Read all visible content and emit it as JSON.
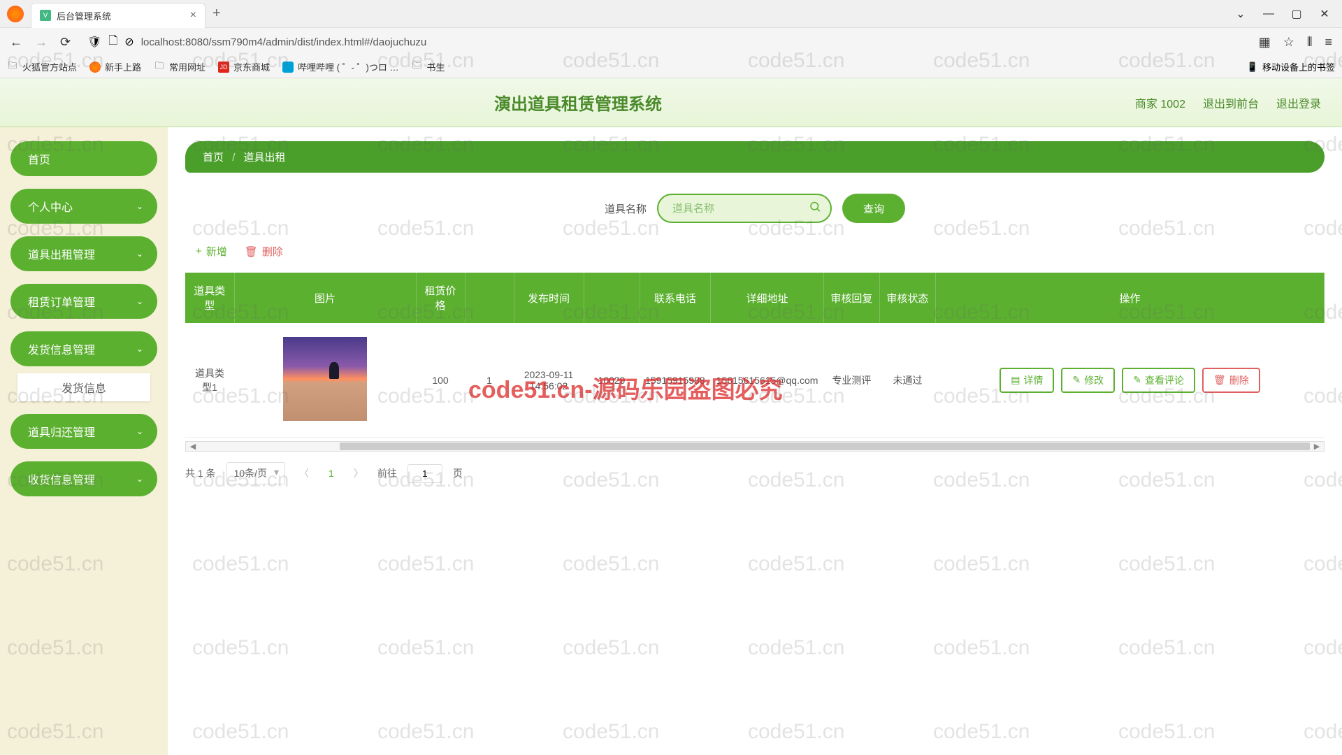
{
  "browser": {
    "tab_title": "后台管理系统",
    "url": "localhost:8080/ssm790m4/admin/dist/index.html#/daojuchuzu",
    "bookmarks": [
      "火狐官方站点",
      "新手上路",
      "常用网址",
      "京东商城",
      "哔哩哔哩 ( ゜- ゜)つロ …",
      "书生"
    ],
    "mobile_bookmarks": "移动设备上的书签"
  },
  "header": {
    "title": "演出道具租赁管理系统",
    "user": "商家 1002",
    "link_front": "退出到前台",
    "link_logout": "退出登录"
  },
  "sidebar": {
    "items": [
      {
        "label": "首页",
        "expandable": false
      },
      {
        "label": "个人中心",
        "expandable": true
      },
      {
        "label": "道具出租管理",
        "expandable": true
      },
      {
        "label": "租赁订单管理",
        "expandable": true
      },
      {
        "label": "发货信息管理",
        "expandable": true
      },
      {
        "label": "道具归还管理",
        "expandable": true
      },
      {
        "label": "收货信息管理",
        "expandable": true
      }
    ],
    "sub_item": "发货信息"
  },
  "breadcrumb": {
    "home": "首页",
    "current": "道具出租"
  },
  "search": {
    "label": "道具名称",
    "placeholder": "道具名称",
    "button": "查询"
  },
  "toolbar": {
    "add": "新增",
    "delete": "删除"
  },
  "table": {
    "headers": [
      "道具类型",
      "图片",
      "租赁价格",
      "",
      "发布时间",
      "",
      "联系电话",
      "详细地址",
      "审核回复",
      "审核状态",
      "操作"
    ],
    "row": {
      "type": "道具类型1",
      "price": "100",
      "col2": "1",
      "publish_time": "2023-09-11 14:56:02",
      "col4": "10029",
      "phone": "15915915988",
      "addr": "15615615615@qq.com",
      "reply": "专业测评",
      "status": "未通过"
    },
    "actions": {
      "detail": "详情",
      "edit": "修改",
      "comments": "查看评论",
      "delete": "删除"
    }
  },
  "pagination": {
    "total": "共 1 条",
    "page_size": "10条/页",
    "current": "1",
    "goto_label": "前往",
    "goto_value": "1",
    "page_suffix": "页"
  },
  "watermark": {
    "text": "code51.cn",
    "red": "code51.cn-源码乐园盗图必究"
  }
}
